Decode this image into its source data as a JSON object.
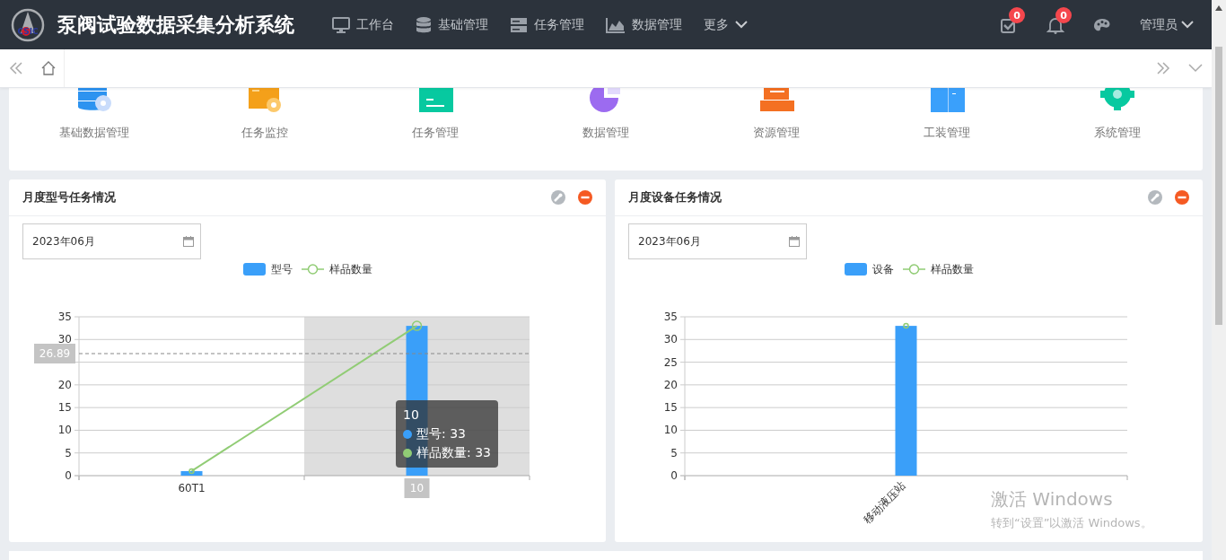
{
  "header": {
    "logo_text": "CSIC",
    "title": "泵阀试验数据采集分析系统",
    "nav": [
      {
        "label": "工作台",
        "kind": "link"
      },
      {
        "label": "基础管理",
        "kind": "link"
      },
      {
        "label": "任务管理",
        "kind": "link"
      },
      {
        "label": "数据管理",
        "kind": "link"
      },
      {
        "label": "更多",
        "kind": "dropdown"
      }
    ],
    "tasks_badge": "0",
    "notifications_badge": "0",
    "user": "管理员"
  },
  "shortcuts": [
    {
      "label": "基础数据管理"
    },
    {
      "label": "任务监控"
    },
    {
      "label": "任务管理"
    },
    {
      "label": "数据管理"
    },
    {
      "label": "资源管理"
    },
    {
      "label": "工装管理"
    },
    {
      "label": "系统管理"
    }
  ],
  "panels": [
    {
      "title": "月度型号任务情况",
      "date": "2023年06月",
      "chart_data": {
        "type": "bar",
        "grid": true,
        "categories": [
          "60T1",
          "10"
        ],
        "ylim": [
          0,
          35
        ],
        "yticks": [
          0,
          5,
          10,
          15,
          20,
          30,
          35
        ],
        "series": [
          {
            "name": "型号",
            "type": "bar",
            "color": "#3a9ff9",
            "values": [
              1,
              33
            ]
          },
          {
            "name": "样品数量",
            "type": "line",
            "marker": "circle",
            "color": "#91cc75",
            "values": [
              1,
              33
            ]
          }
        ]
      },
      "pointer": {
        "y_label": "26.89",
        "columns": [
          {
            "selected": false
          },
          {
            "selected": true
          }
        ]
      },
      "tooltip": {
        "title": "10",
        "rows": [
          {
            "label": "型号: 33",
            "color": "#3a9ff9"
          },
          {
            "label": "样品数量: 33",
            "color": "#91cc75"
          }
        ]
      }
    },
    {
      "title": "月度设备任务情况",
      "date": "2023年06月",
      "chart_data": {
        "type": "bar",
        "grid": true,
        "categories": [
          "移动液压站"
        ],
        "ylim": [
          0,
          35
        ],
        "yticks": [
          0,
          5,
          10,
          15,
          20,
          25,
          30,
          35
        ],
        "series": [
          {
            "name": "设备",
            "type": "bar",
            "color": "#3a9ff9",
            "values": [
              33
            ]
          },
          {
            "name": "样品数量",
            "type": "line",
            "marker": "circle",
            "color": "#91cc75",
            "values": [
              33
            ]
          }
        ]
      }
    }
  ],
  "os_overlay": {
    "line1": "激活 Windows",
    "line2": "转到“设置”以激活 Windows。"
  }
}
